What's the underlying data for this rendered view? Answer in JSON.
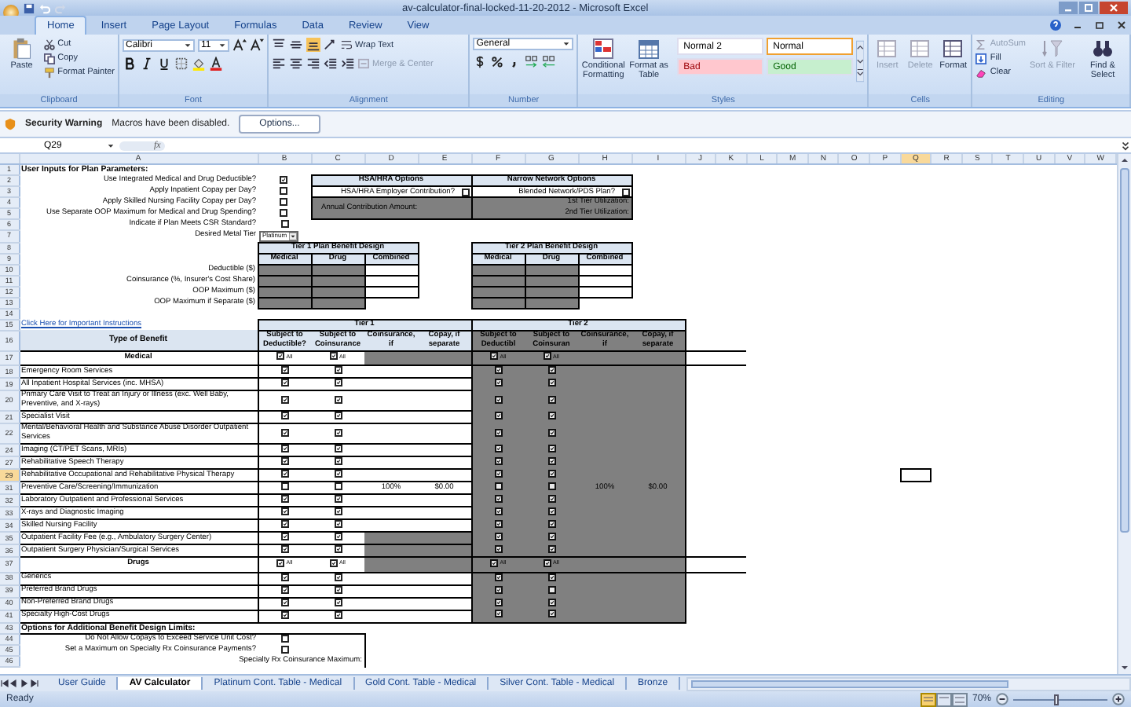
{
  "window": {
    "title": "av-calculator-final-locked-11-20-2012 - Microsoft Excel"
  },
  "ribbon_tabs": [
    {
      "label": "Home",
      "selected": true
    },
    {
      "label": "Insert",
      "selected": false
    },
    {
      "label": "Page Layout",
      "selected": false
    },
    {
      "label": "Formulas",
      "selected": false
    },
    {
      "label": "Data",
      "selected": false
    },
    {
      "label": "Review",
      "selected": false
    },
    {
      "label": "View",
      "selected": false
    }
  ],
  "ribbon": {
    "clipboard": {
      "paste": "Paste",
      "cut": "Cut",
      "copy": "Copy",
      "format_painter": "Format Painter",
      "label": "Clipboard"
    },
    "font": {
      "name": "Calibri",
      "size": "11",
      "label": "Font"
    },
    "alignment": {
      "wrap": "Wrap Text",
      "merge": "Merge & Center",
      "label": "Alignment"
    },
    "number": {
      "format": "General",
      "label": "Number"
    },
    "styles": {
      "conditional": "Conditional Formatting",
      "format_table": "Format as Table",
      "label": "Styles",
      "cells": [
        {
          "label": "Normal 2",
          "kind": "plain",
          "selected": false
        },
        {
          "label": "Normal",
          "kind": "plain",
          "selected": true
        },
        {
          "label": "Bad",
          "kind": "bad",
          "selected": false
        },
        {
          "label": "Good",
          "kind": "good",
          "selected": false
        }
      ]
    },
    "cells": {
      "label": "Cells",
      "buttons": [
        {
          "label": "Insert",
          "disabled": true
        },
        {
          "label": "Delete",
          "disabled": true
        },
        {
          "label": "Format",
          "disabled": false
        }
      ]
    },
    "editing": {
      "autosum": "AutoSum",
      "fill": "Fill",
      "clear": "Clear",
      "sort": "Sort & Filter",
      "find": "Find & Select",
      "label": "Editing"
    }
  },
  "security": {
    "title": "Security Warning",
    "message": "Macros have been disabled.",
    "button": "Options..."
  },
  "formula_bar": {
    "name_box": "Q29",
    "function_label": "fx"
  },
  "columns": [
    {
      "letter": "A",
      "selected": false
    },
    {
      "letter": "B",
      "selected": false
    },
    {
      "letter": "C",
      "selected": false
    },
    {
      "letter": "D",
      "selected": false
    },
    {
      "letter": "E",
      "selected": false
    },
    {
      "letter": "F",
      "selected": false
    },
    {
      "letter": "G",
      "selected": false
    },
    {
      "letter": "H",
      "selected": false
    },
    {
      "letter": "I",
      "selected": false
    },
    {
      "letter": "J",
      "selected": false
    },
    {
      "letter": "K",
      "selected": false
    },
    {
      "letter": "L",
      "selected": false
    },
    {
      "letter": "M",
      "selected": false
    },
    {
      "letter": "N",
      "selected": false
    },
    {
      "letter": "O",
      "selected": false
    },
    {
      "letter": "P",
      "selected": false
    },
    {
      "letter": "Q",
      "selected": true
    },
    {
      "letter": "R",
      "selected": false
    },
    {
      "letter": "S",
      "selected": false
    },
    {
      "letter": "T",
      "selected": false
    },
    {
      "letter": "U",
      "selected": false
    },
    {
      "letter": "V",
      "selected": false
    },
    {
      "letter": "W",
      "selected": false
    }
  ],
  "sheet": {
    "title_row": {
      "row": "1",
      "text": "User Inputs for Plan Parameters:"
    },
    "params": [
      {
        "row": "2",
        "label": "Use Integrated Medical and Drug Deductible?",
        "checked": true
      },
      {
        "row": "3",
        "label": "Apply Inpatient Copay per Day?",
        "checked": false
      },
      {
        "row": "4",
        "label": "Apply Skilled Nursing Facility Copay per Day?",
        "checked": false
      },
      {
        "row": "5",
        "label": "Use Separate OOP Maximum for Medical and Drug Spending?",
        "checked": false
      },
      {
        "row": "6",
        "label": "Indicate if Plan Meets CSR Standard?",
        "checked": false
      }
    ],
    "metal_tier": {
      "row": "7",
      "label": "Desired Metal Tier",
      "value": "Platinum"
    },
    "hsa": {
      "title": "HSA/HRA Options",
      "question": "HSA/HRA Employer Contribution?",
      "checked": false,
      "amount_label": "Annual Contribution Amount:"
    },
    "narrow": {
      "title": "Narrow Network Options",
      "question": "Blended Network/PDS Plan?",
      "checked": false,
      "tier1": "1st Tier Utilization:",
      "tier2": "2nd Tier Utilization:"
    },
    "design": {
      "title_row": "8",
      "header_row": "9",
      "titles": [
        "Tier 1 Plan Benefit Design",
        "Tier 2 Plan Benefit Design"
      ],
      "columns": [
        "Medical",
        "Drug",
        "Combined",
        "Medical",
        "Drug",
        "Combined"
      ],
      "rows": [
        {
          "row": "10",
          "label": "Deductible ($)",
          "shaded": [
            true,
            true,
            false,
            true,
            true,
            false
          ]
        },
        {
          "row": "11",
          "label": "Coinsurance (%, Insurer's Cost Share)",
          "shaded": [
            true,
            true,
            false,
            true,
            true,
            false
          ]
        },
        {
          "row": "12",
          "label": "OOP Maximum ($)",
          "shaded": [
            true,
            true,
            false,
            true,
            true,
            false
          ]
        },
        {
          "row": "13",
          "label": "OOP Maximum if Separate ($)",
          "shaded": [
            true,
            true,
            false,
            true,
            true,
            false
          ]
        }
      ]
    },
    "blank_row": "14",
    "link": {
      "row": "15",
      "text": "Click Here for Important Instructions"
    },
    "benefits": {
      "tiers": [
        "Tier 1",
        "Tier 2"
      ],
      "header_row": "16",
      "type_header": "Type of Benefit",
      "columns": [
        "Subject to Deductible?",
        "Subject to Coinsurance",
        "Coinsurance, if",
        "Copay, if separate",
        "Subject to Deductibl",
        "Subject to Coinsuran",
        "Coinsurance, if",
        "Copay, if separate"
      ],
      "rows": [
        {
          "row": "17",
          "kind": "section",
          "label": "Medical",
          "selected": false,
          "tier1": {
            "deductible": true,
            "coinsurance": true,
            "deductible_note": "All",
            "coinsurance_note": "All"
          },
          "tier2": {
            "deductible": true,
            "coinsurance": true,
            "deductible_note": "All",
            "coinsurance_note": "All"
          }
        },
        {
          "row": "18",
          "kind": "benefit",
          "label": "Emergency Room Services",
          "selected": false,
          "tier1": {
            "deductible": true,
            "coinsurance": true,
            "shaded": false
          },
          "tier2": {
            "deductible": true,
            "coinsurance": true
          }
        },
        {
          "row": "19",
          "kind": "benefit",
          "label": "All Inpatient Hospital Services (inc. MHSA)",
          "selected": false,
          "tier1": {
            "deductible": true,
            "coinsurance": true,
            "shaded": false
          },
          "tier2": {
            "deductible": true,
            "coinsurance": true
          }
        },
        {
          "row": "20",
          "kind": "benefit",
          "label": "Primary Care Visit to Treat an Injury or Illness (exc. Well Baby, Preventive, and X-rays)",
          "selected": false,
          "tier1": {
            "deductible": true,
            "coinsurance": true,
            "shaded": false
          },
          "tier2": {
            "deductible": true,
            "coinsurance": true
          }
        },
        {
          "row": "21",
          "kind": "benefit",
          "label": "Specialist Visit",
          "selected": false,
          "tier1": {
            "deductible": true,
            "coinsurance": true,
            "shaded": false
          },
          "tier2": {
            "deductible": true,
            "coinsurance": true
          }
        },
        {
          "row": "22",
          "kind": "benefit",
          "label": "Mental/Behavioral Health and Substance Abuse Disorder Outpatient Services",
          "selected": false,
          "tier1": {
            "deductible": true,
            "coinsurance": true,
            "shaded": false
          },
          "tier2": {
            "deductible": true,
            "coinsurance": true
          }
        },
        {
          "row": "24",
          "kind": "benefit",
          "label": "Imaging (CT/PET Scans, MRIs)",
          "selected": false,
          "tier1": {
            "deductible": true,
            "coinsurance": true,
            "shaded": false
          },
          "tier2": {
            "deductible": true,
            "coinsurance": true
          }
        },
        {
          "row": "27",
          "kind": "benefit",
          "label": "Rehabilitative Speech Therapy",
          "selected": false,
          "tier1": {
            "deductible": true,
            "coinsurance": true,
            "shaded": false
          },
          "tier2": {
            "deductible": true,
            "coinsurance": true
          }
        },
        {
          "row": "29",
          "kind": "benefit",
          "label": "Rehabilitative Occupational and Rehabilitative Physical Therapy",
          "selected": true,
          "tier1": {
            "deductible": true,
            "coinsurance": true,
            "shaded": false
          },
          "tier2": {
            "deductible": true,
            "coinsurance": true
          }
        },
        {
          "row": "31",
          "kind": "benefit",
          "label": "Preventive Care/Screening/Immunization",
          "selected": false,
          "tier1": {
            "deductible": false,
            "coinsurance": false,
            "shaded": false,
            "coinsurance_value": "100%",
            "copay": "$0.00"
          },
          "tier2": {
            "deductible": false,
            "coinsurance": false,
            "coinsurance_value": "100%",
            "copay": "$0.00"
          }
        },
        {
          "row": "32",
          "kind": "benefit",
          "label": "Laboratory Outpatient and Professional Services",
          "selected": false,
          "tier1": {
            "deductible": true,
            "coinsurance": true,
            "shaded": false
          },
          "tier2": {
            "deductible": true,
            "coinsurance": true
          }
        },
        {
          "row": "33",
          "kind": "benefit",
          "label": "X-rays and Diagnostic Imaging",
          "selected": false,
          "tier1": {
            "deductible": true,
            "coinsurance": true,
            "shaded": false
          },
          "tier2": {
            "deductible": true,
            "coinsurance": true
          }
        },
        {
          "row": "34",
          "kind": "benefit",
          "label": "Skilled Nursing Facility",
          "selected": false,
          "tier1": {
            "deductible": true,
            "coinsurance": true,
            "shaded": false
          },
          "tier2": {
            "deductible": true,
            "coinsurance": true
          }
        },
        {
          "row": "35",
          "kind": "benefit",
          "label": "Outpatient Facility Fee (e.g.,  Ambulatory Surgery Center)",
          "selected": false,
          "tier1": {
            "deductible": true,
            "coinsurance": true,
            "shaded": true
          },
          "tier2": {
            "deductible": true,
            "coinsurance": true
          }
        },
        {
          "row": "36",
          "kind": "benefit",
          "label": "Outpatient Surgery Physician/Surgical Services",
          "selected": false,
          "tier1": {
            "deductible": true,
            "coinsurance": true,
            "shaded": true
          },
          "tier2": {
            "deductible": true,
            "coinsurance": true
          }
        },
        {
          "row": "37",
          "kind": "section",
          "label": "Drugs",
          "selected": false,
          "tier1": {
            "deductible": true,
            "coinsurance": true,
            "deductible_note": "All",
            "coinsurance_note": "All"
          },
          "tier2": {
            "deductible": true,
            "coinsurance": true,
            "deductible_note": "All",
            "coinsurance_note": "All"
          }
        },
        {
          "row": "38",
          "kind": "benefit",
          "label": "Generics",
          "selected": false,
          "tier1": {
            "deductible": true,
            "coinsurance": true,
            "shaded": false
          },
          "tier2": {
            "deductible": true,
            "coinsurance": true
          }
        },
        {
          "row": "39",
          "kind": "benefit",
          "label": "Preferred Brand Drugs",
          "selected": false,
          "tier1": {
            "deductible": true,
            "coinsurance": true,
            "shaded": false
          },
          "tier2": {
            "deductible": true,
            "coinsurance": false
          }
        },
        {
          "row": "40",
          "kind": "benefit",
          "label": "Non-Preferred Brand Drugs",
          "selected": false,
          "tier1": {
            "deductible": true,
            "coinsurance": true,
            "shaded": false
          },
          "tier2": {
            "deductible": true,
            "coinsurance": true
          }
        },
        {
          "row": "41",
          "kind": "benefit",
          "label": "Specialty High-Cost Drugs",
          "selected": false,
          "tier1": {
            "deductible": true,
            "coinsurance": true,
            "shaded": false
          },
          "tier2": {
            "deductible": true,
            "coinsurance": true
          }
        }
      ]
    },
    "limits": {
      "title_row": "43",
      "title": "Options for Additional Benefit Design Limits:",
      "items": [
        {
          "row": "44",
          "kind": "checkbox",
          "label": "Do Not Allow Copays to Exceed Service Unit Cost?",
          "checked": false
        },
        {
          "row": "45",
          "kind": "checkbox",
          "label": "Set a Maximum on Specialty Rx Coinsurance Payments?",
          "checked": false
        },
        {
          "row": "46",
          "kind": "input",
          "label": "Specialty Rx Coinsurance Maximum:"
        }
      ]
    }
  },
  "sheet_tabs": [
    {
      "label": "User Guide",
      "selected": false
    },
    {
      "label": "AV Calculator",
      "selected": true
    },
    {
      "label": "Platinum Cont. Table - Medical",
      "selected": false
    },
    {
      "label": "Gold Cont. Table - Medical",
      "selected": false
    },
    {
      "label": "Silver Cont. Table - Medical",
      "selected": false
    },
    {
      "label": "Bronze",
      "selected": false
    }
  ],
  "status_bar": {
    "status": "Ready",
    "zoom": "70%",
    "zoom_slider": {
      "level": 0.45
    }
  }
}
